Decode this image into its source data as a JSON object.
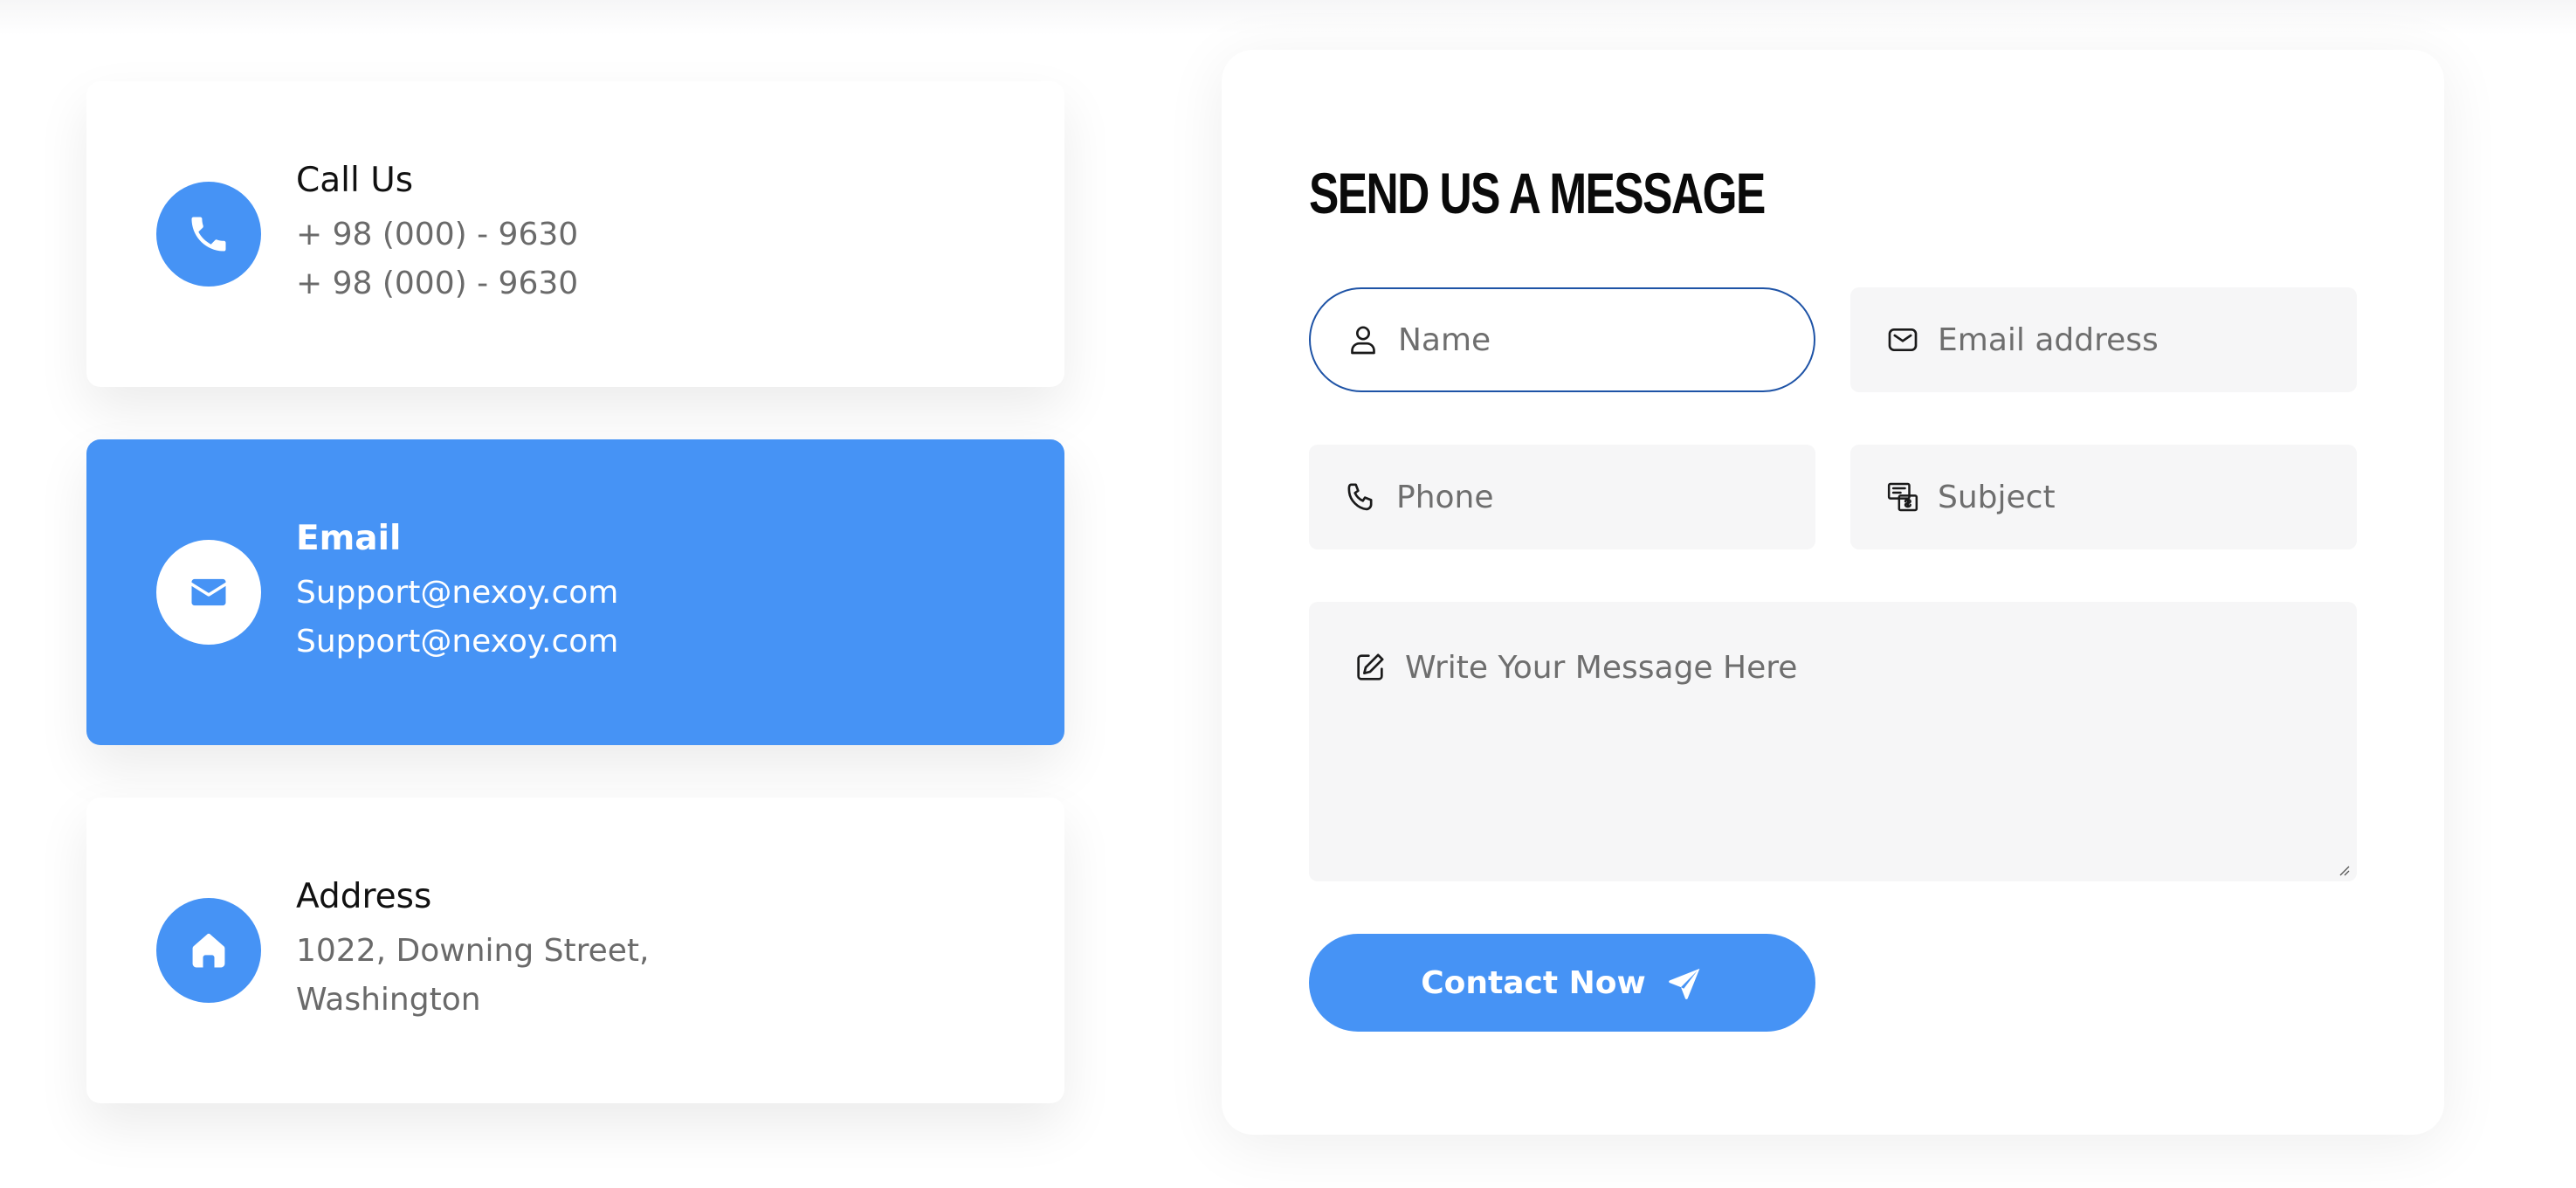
{
  "colors": {
    "accent": "#4693f5",
    "focus_border": "#1e53a6",
    "field_bg": "#f6f6f7",
    "muted_text": "#6a6a6a"
  },
  "info_cards": [
    {
      "title": "Call Us",
      "icon": "phone-icon",
      "lines": [
        "+ 98 (000) - 9630",
        "+ 98 (000) - 9630"
      ],
      "active": false
    },
    {
      "title": "Email",
      "icon": "envelope-icon",
      "lines": [
        "Support@nexoy.com",
        "Support@nexoy.com"
      ],
      "active": true
    },
    {
      "title": "Address",
      "icon": "home-icon",
      "lines": [
        "1022, Downing Street,",
        "Washington"
      ],
      "active": false
    }
  ],
  "form": {
    "title": "SEND US A MESSAGE",
    "fields": {
      "name": {
        "placeholder": "Name",
        "value": "",
        "icon": "user-icon",
        "focused": true
      },
      "email": {
        "placeholder": "Email address",
        "value": "",
        "icon": "envelope-outline-icon"
      },
      "phone": {
        "placeholder": "Phone",
        "value": "",
        "icon": "phone-outline-icon"
      },
      "subject": {
        "placeholder": "Subject",
        "value": "",
        "icon": "subject-icon"
      },
      "message": {
        "placeholder": "Write Your Message Here",
        "value": "",
        "icon": "edit-icon"
      }
    },
    "submit_label": "Contact Now",
    "submit_icon": "send-icon"
  }
}
